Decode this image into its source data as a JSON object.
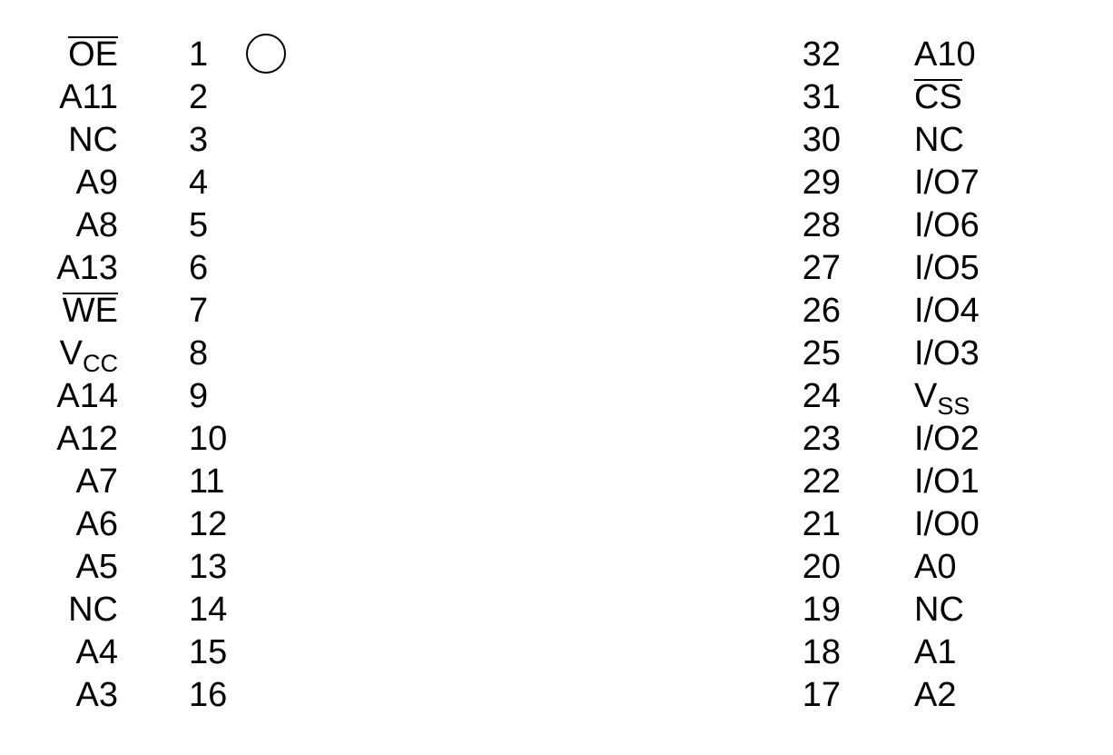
{
  "left_side": [
    {
      "pin": "1",
      "signal": "OE",
      "sub": "",
      "active_low": true
    },
    {
      "pin": "2",
      "signal": "A11",
      "sub": "",
      "active_low": false
    },
    {
      "pin": "3",
      "signal": "NC",
      "sub": "",
      "active_low": false
    },
    {
      "pin": "4",
      "signal": "A9",
      "sub": "",
      "active_low": false
    },
    {
      "pin": "5",
      "signal": "A8",
      "sub": "",
      "active_low": false
    },
    {
      "pin": "6",
      "signal": "A13",
      "sub": "",
      "active_low": false
    },
    {
      "pin": "7",
      "signal": "WE",
      "sub": "",
      "active_low": true
    },
    {
      "pin": "8",
      "signal": "V",
      "sub": "CC",
      "active_low": false
    },
    {
      "pin": "9",
      "signal": "A14",
      "sub": "",
      "active_low": false
    },
    {
      "pin": "10",
      "signal": "A12",
      "sub": "",
      "active_low": false
    },
    {
      "pin": "11",
      "signal": "A7",
      "sub": "",
      "active_low": false
    },
    {
      "pin": "12",
      "signal": "A6",
      "sub": "",
      "active_low": false
    },
    {
      "pin": "13",
      "signal": "A5",
      "sub": "",
      "active_low": false
    },
    {
      "pin": "14",
      "signal": "NC",
      "sub": "",
      "active_low": false
    },
    {
      "pin": "15",
      "signal": "A4",
      "sub": "",
      "active_low": false
    },
    {
      "pin": "16",
      "signal": "A3",
      "sub": "",
      "active_low": false
    }
  ],
  "right_side": [
    {
      "pin": "32",
      "signal": "A10",
      "sub": "",
      "active_low": false
    },
    {
      "pin": "31",
      "signal": "CS",
      "sub": "",
      "active_low": true
    },
    {
      "pin": "30",
      "signal": "NC",
      "sub": "",
      "active_low": false
    },
    {
      "pin": "29",
      "signal": "I/O7",
      "sub": "",
      "active_low": false
    },
    {
      "pin": "28",
      "signal": "I/O6",
      "sub": "",
      "active_low": false
    },
    {
      "pin": "27",
      "signal": "I/O5",
      "sub": "",
      "active_low": false
    },
    {
      "pin": "26",
      "signal": "I/O4",
      "sub": "",
      "active_low": false
    },
    {
      "pin": "25",
      "signal": "I/O3",
      "sub": "",
      "active_low": false
    },
    {
      "pin": "24",
      "signal": "V",
      "sub": "SS",
      "active_low": false
    },
    {
      "pin": "23",
      "signal": "I/O2",
      "sub": "",
      "active_low": false
    },
    {
      "pin": "22",
      "signal": "I/O1",
      "sub": "",
      "active_low": false
    },
    {
      "pin": "21",
      "signal": "I/O0",
      "sub": "",
      "active_low": false
    },
    {
      "pin": "20",
      "signal": "A0",
      "sub": "",
      "active_low": false
    },
    {
      "pin": "19",
      "signal": "NC",
      "sub": "",
      "active_low": false
    },
    {
      "pin": "18",
      "signal": "A1",
      "sub": "",
      "active_low": false
    },
    {
      "pin": "17",
      "signal": "A2",
      "sub": "",
      "active_low": false
    }
  ]
}
